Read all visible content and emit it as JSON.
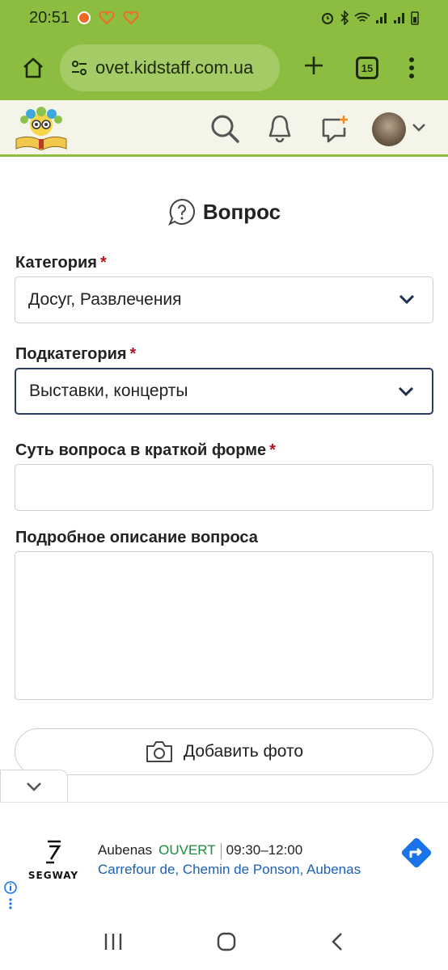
{
  "status_bar": {
    "time": "20:51"
  },
  "browser": {
    "url": "ovet.kidstaff.com.ua",
    "tab_count": "15"
  },
  "form": {
    "title": "Вопрос",
    "category": {
      "label": "Категория",
      "required_mark": "*",
      "value": "Досуг, Развлечения"
    },
    "subcategory": {
      "label": "Подкатегория",
      "required_mark": "*",
      "value": "Выставки, концерты"
    },
    "summary": {
      "label": "Суть вопроса в краткой форме",
      "required_mark": "*",
      "value": ""
    },
    "description": {
      "label": "Подробное описание вопроса",
      "value": ""
    },
    "add_photo_label": "Добавить фото"
  },
  "ad": {
    "brand": "SEGWAY",
    "city": "Aubenas",
    "status": "OUVERT",
    "hours": "09:30–12:00",
    "address": "Carrefour de, Chemin de Ponson, Aubenas"
  },
  "colors": {
    "theme_green": "#8dbd40",
    "header_bg": "#f4f4e9",
    "required_red": "#b4121e",
    "ad_open_green": "#1a8a3c",
    "ad_link_blue": "#1a5fb4",
    "direction_blue": "#1a73e8"
  }
}
